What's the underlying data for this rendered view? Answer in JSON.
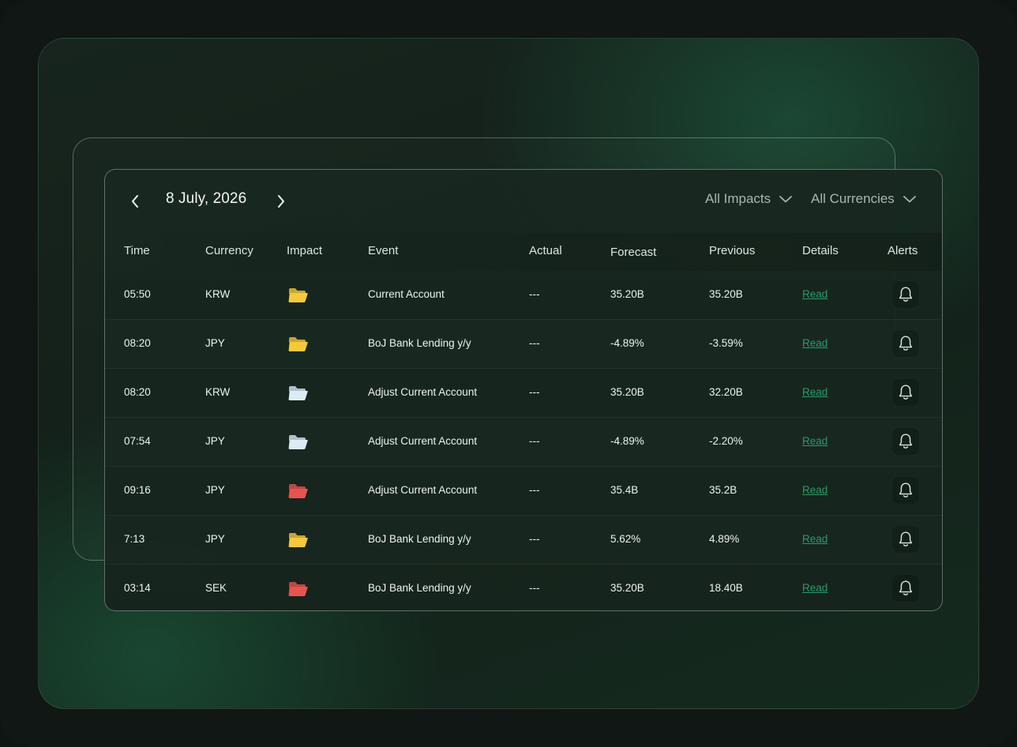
{
  "calendar": {
    "date": "8 July, 2026",
    "filters": {
      "impacts": "All Impacts",
      "currencies": "All Currencies"
    },
    "columns": [
      "Time",
      "Currency",
      "Impact",
      "Event",
      "Actual",
      "Forecast",
      "Previous",
      "Details",
      "Alerts"
    ],
    "impact_colors": {
      "medium": "#f6c93c",
      "low": "#dcecf5",
      "high": "#e8534e"
    },
    "accent_color": "#2a9a6a",
    "rows": [
      {
        "time": "05:50",
        "currency": "KRW",
        "impact": "medium",
        "event": "Current Account",
        "actual": "---",
        "forecast": "35.20B",
        "previous": "35.20B",
        "details": "Read"
      },
      {
        "time": "08:20",
        "currency": "JPY",
        "impact": "medium",
        "event": "BoJ Bank Lending y/y",
        "actual": "---",
        "forecast": "-4.89%",
        "previous": "-3.59%",
        "details": "Read"
      },
      {
        "time": "08:20",
        "currency": "KRW",
        "impact": "low",
        "event": "Adjust Current Account",
        "actual": "---",
        "forecast": "35.20B",
        "previous": "32.20B",
        "details": "Read"
      },
      {
        "time": "07:54",
        "currency": "JPY",
        "impact": "low",
        "event": "Adjust Current Account",
        "actual": "---",
        "forecast": "-4.89%",
        "previous": "-2.20%",
        "details": "Read"
      },
      {
        "time": "09:16",
        "currency": "JPY",
        "impact": "high",
        "event": "Adjust Current Account",
        "actual": "---",
        "forecast": "35.4B",
        "previous": "35.2B",
        "details": "Read"
      },
      {
        "time": "7:13",
        "currency": "JPY",
        "impact": "medium",
        "event": "BoJ Bank Lending y/y",
        "actual": "---",
        "forecast": "5.62%",
        "previous": "4.89%",
        "details": "Read"
      },
      {
        "time": "03:14",
        "currency": "SEK",
        "impact": "high",
        "event": "BoJ Bank Lending y/y",
        "actual": "---",
        "forecast": "35.20B",
        "previous": "18.40B",
        "details": "Read"
      }
    ]
  }
}
